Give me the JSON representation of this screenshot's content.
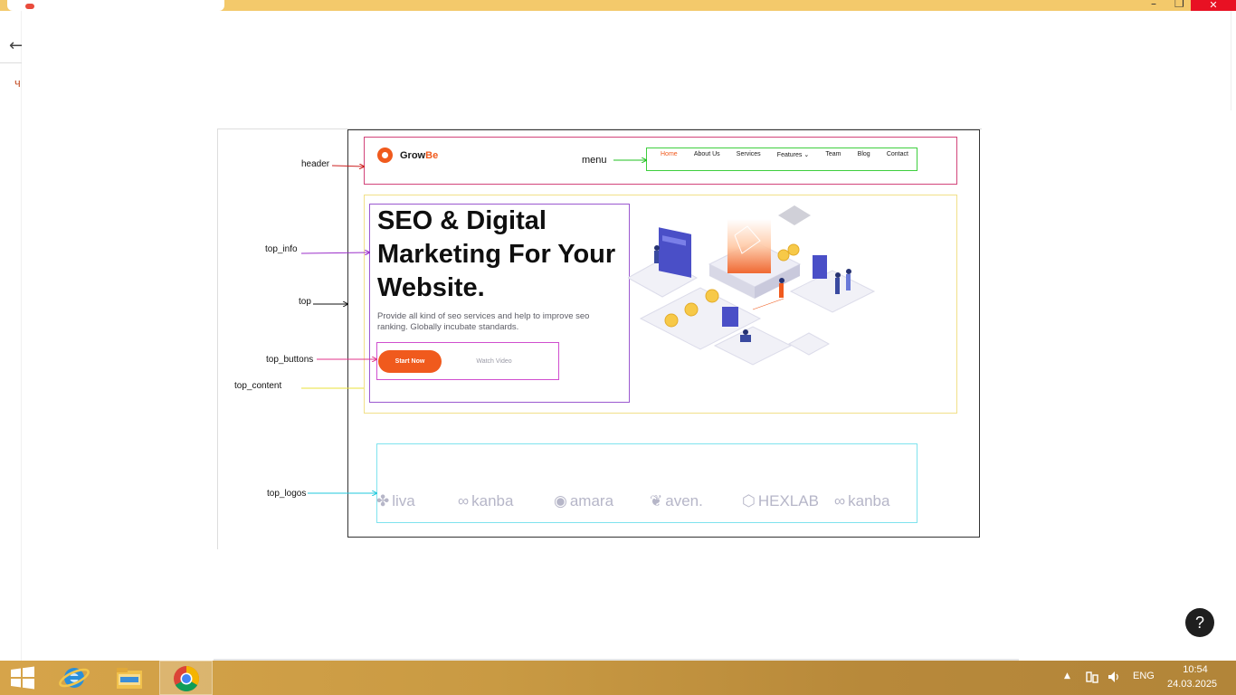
{
  "window": {
    "close_glyph": "✕",
    "back_glyph": "←",
    "left_char": "ч"
  },
  "annotations": {
    "header": "header",
    "menu": "menu",
    "top_info": "top_info",
    "top": "top",
    "top_buttons": "top_buttons",
    "top_content": "top_content",
    "top_logos": "top_logos"
  },
  "site": {
    "logo": {
      "name_part1": "Grow",
      "name_part2": "Be",
      "accent_color": "#f05a1d"
    },
    "menu": [
      "Home",
      "About Us",
      "Services",
      "Features ⌄",
      "Team",
      "Blog",
      "Contact"
    ],
    "menu_active_index": 0,
    "hero": {
      "title": "SEO & Digital Marketing For Your Website.",
      "subtitle": "Provide all kind of seo services and help to improve seo ranking. Globally incubate standards.",
      "primary_button": "Start Now",
      "secondary_button": "Watch Video"
    },
    "logos": [
      "liva",
      "kanba",
      "amara",
      "aven.",
      "HEXLAB",
      "kanba"
    ]
  },
  "taskbar": {
    "language": "ENG",
    "time": "10:54",
    "date": "24.03.2025",
    "tray_expand": "▲"
  },
  "help": {
    "label": "?"
  }
}
